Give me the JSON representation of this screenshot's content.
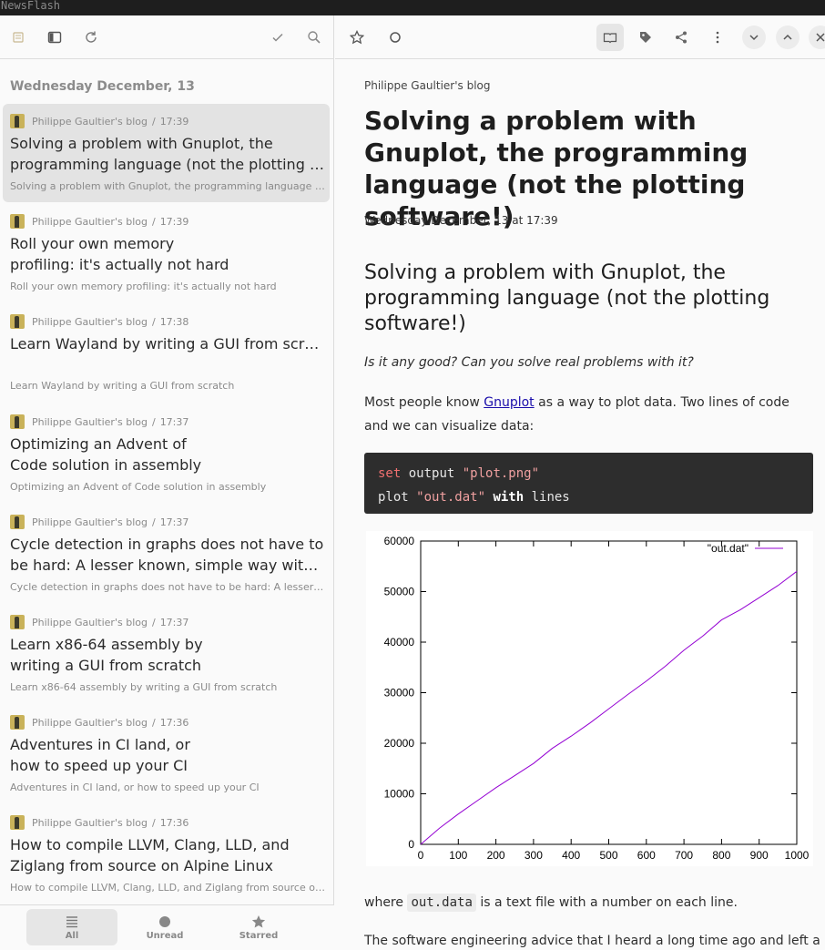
{
  "window": {
    "title": "NewsFlash"
  },
  "list_toolbar": {
    "icons": [
      "feeds-icon",
      "sidebar-toggle-icon",
      "refresh-icon",
      "mark-read-icon",
      "search-icon"
    ]
  },
  "day_header": "Wednesday December, 13",
  "articles": [
    {
      "feed": "Philippe Gaultier's blog",
      "sep": "/",
      "time": "17:39",
      "title_lines": [
        "Solving a problem with Gnuplot, the",
        "programming language (not the plotting software!)"
      ],
      "summary": "Solving a problem with Gnuplot, the programming language (not the plotting software!)"
    },
    {
      "feed": "Philippe Gaultier's blog",
      "sep": "/",
      "time": "17:39",
      "title_lines": [
        "Roll your own memory",
        "profiling: it's actually not hard"
      ],
      "summary": "Roll your own memory profiling: it's actually not hard"
    },
    {
      "feed": "Philippe Gaultier's blog",
      "sep": "/",
      "time": "17:38",
      "title_lines": [
        "Learn Wayland by writing a GUI from scratch"
      ],
      "summary": "Learn Wayland by writing a GUI from scratch"
    },
    {
      "feed": "Philippe Gaultier's blog",
      "sep": "/",
      "time": "17:37",
      "title_lines": [
        "Optimizing an Advent of",
        "Code solution in assembly"
      ],
      "summary": "Optimizing an Advent of Code solution in assembly"
    },
    {
      "feed": "Philippe Gaultier's blog",
      "sep": "/",
      "time": "17:37",
      "title_lines": [
        "Cycle detection in graphs does not have to",
        "be hard: A lesser known, simple way with Kahn's algorithm"
      ],
      "summary": "Cycle detection in graphs does not have to be hard: A lesser known, simple way with Kahn's algorithm"
    },
    {
      "feed": "Philippe Gaultier's blog",
      "sep": "/",
      "time": "17:37",
      "title_lines": [
        "Learn x86-64 assembly by",
        "writing a GUI from scratch"
      ],
      "summary": "Learn x86-64 assembly by writing a GUI from scratch"
    },
    {
      "feed": "Philippe Gaultier's blog",
      "sep": "/",
      "time": "17:36",
      "title_lines": [
        "Adventures in CI land, or",
        "how to speed up your CI"
      ],
      "summary": "Adventures in CI land, or how to speed up your CI"
    },
    {
      "feed": "Philippe Gaultier's blog",
      "sep": "/",
      "time": "17:36",
      "title_lines": [
        "How to compile LLVM, Clang, LLD, and",
        "Ziglang from source on Alpine Linux"
      ],
      "summary": "How to compile LLVM, Clang, LLD, and Ziglang from source on Alpine Linux"
    }
  ],
  "bottom_bar": {
    "all": "All",
    "unread": "Unread",
    "starred": "Starred"
  },
  "article_toolbar": {
    "icons": [
      "star-icon",
      "unread-circle-icon",
      "reader-mode-icon",
      "tag-icon",
      "share-icon",
      "menu-icon",
      "next-article-icon",
      "previous-article-icon",
      "close-icon"
    ]
  },
  "article": {
    "feed_name": "Philippe Gaultier's blog",
    "title": "Solving a problem with Gnuplot, the programming language (not the plotting software!)",
    "date": "Wednesday December, 13 at 17:39",
    "heading": "Solving a problem with Gnuplot, the programming language (not the plotting software!)",
    "subtitle": "Is it any good? Can you solve real problems with it?",
    "para1_before": "Most people know ",
    "para1_link": "Gnuplot",
    "para1_after": " as a way to plot data. Two lines of code and we can visualize data:",
    "code": {
      "line1_kw": "set",
      "line1_mid": " output ",
      "line1_str": "\"plot.png\"",
      "line2_kw": "plot",
      "line2_str": " \"out.dat\" ",
      "line2_bold": "with",
      "line2_end": " lines"
    },
    "para2_before": "where ",
    "para2_code": "out.data",
    "para2_after": " is a text file with a number on each line.",
    "para3": "The software engineering advice that I heard a long time ago and left a mark"
  },
  "chart_data": {
    "type": "line",
    "legend": "\"out.dat\"",
    "legend_position": "top-right",
    "line_color": "#9400d3",
    "xlim": [
      0,
      1000
    ],
    "ylim": [
      0,
      60000
    ],
    "x_ticks": [
      "0",
      "100",
      "200",
      "300",
      "400",
      "500",
      "600",
      "700",
      "800",
      "900",
      "1000"
    ],
    "y_ticks": [
      "0",
      "10000",
      "20000",
      "30000",
      "40000",
      "50000",
      "60000"
    ],
    "x": [
      0,
      50,
      100,
      150,
      200,
      250,
      300,
      350,
      400,
      450,
      500,
      550,
      600,
      650,
      700,
      750,
      800,
      850,
      900,
      950,
      1000
    ],
    "y": [
      0,
      3200,
      6000,
      8600,
      11200,
      13600,
      16000,
      19000,
      21400,
      24000,
      26800,
      29600,
      32300,
      35200,
      38400,
      41200,
      44400,
      46400,
      48800,
      51200,
      54000
    ]
  }
}
